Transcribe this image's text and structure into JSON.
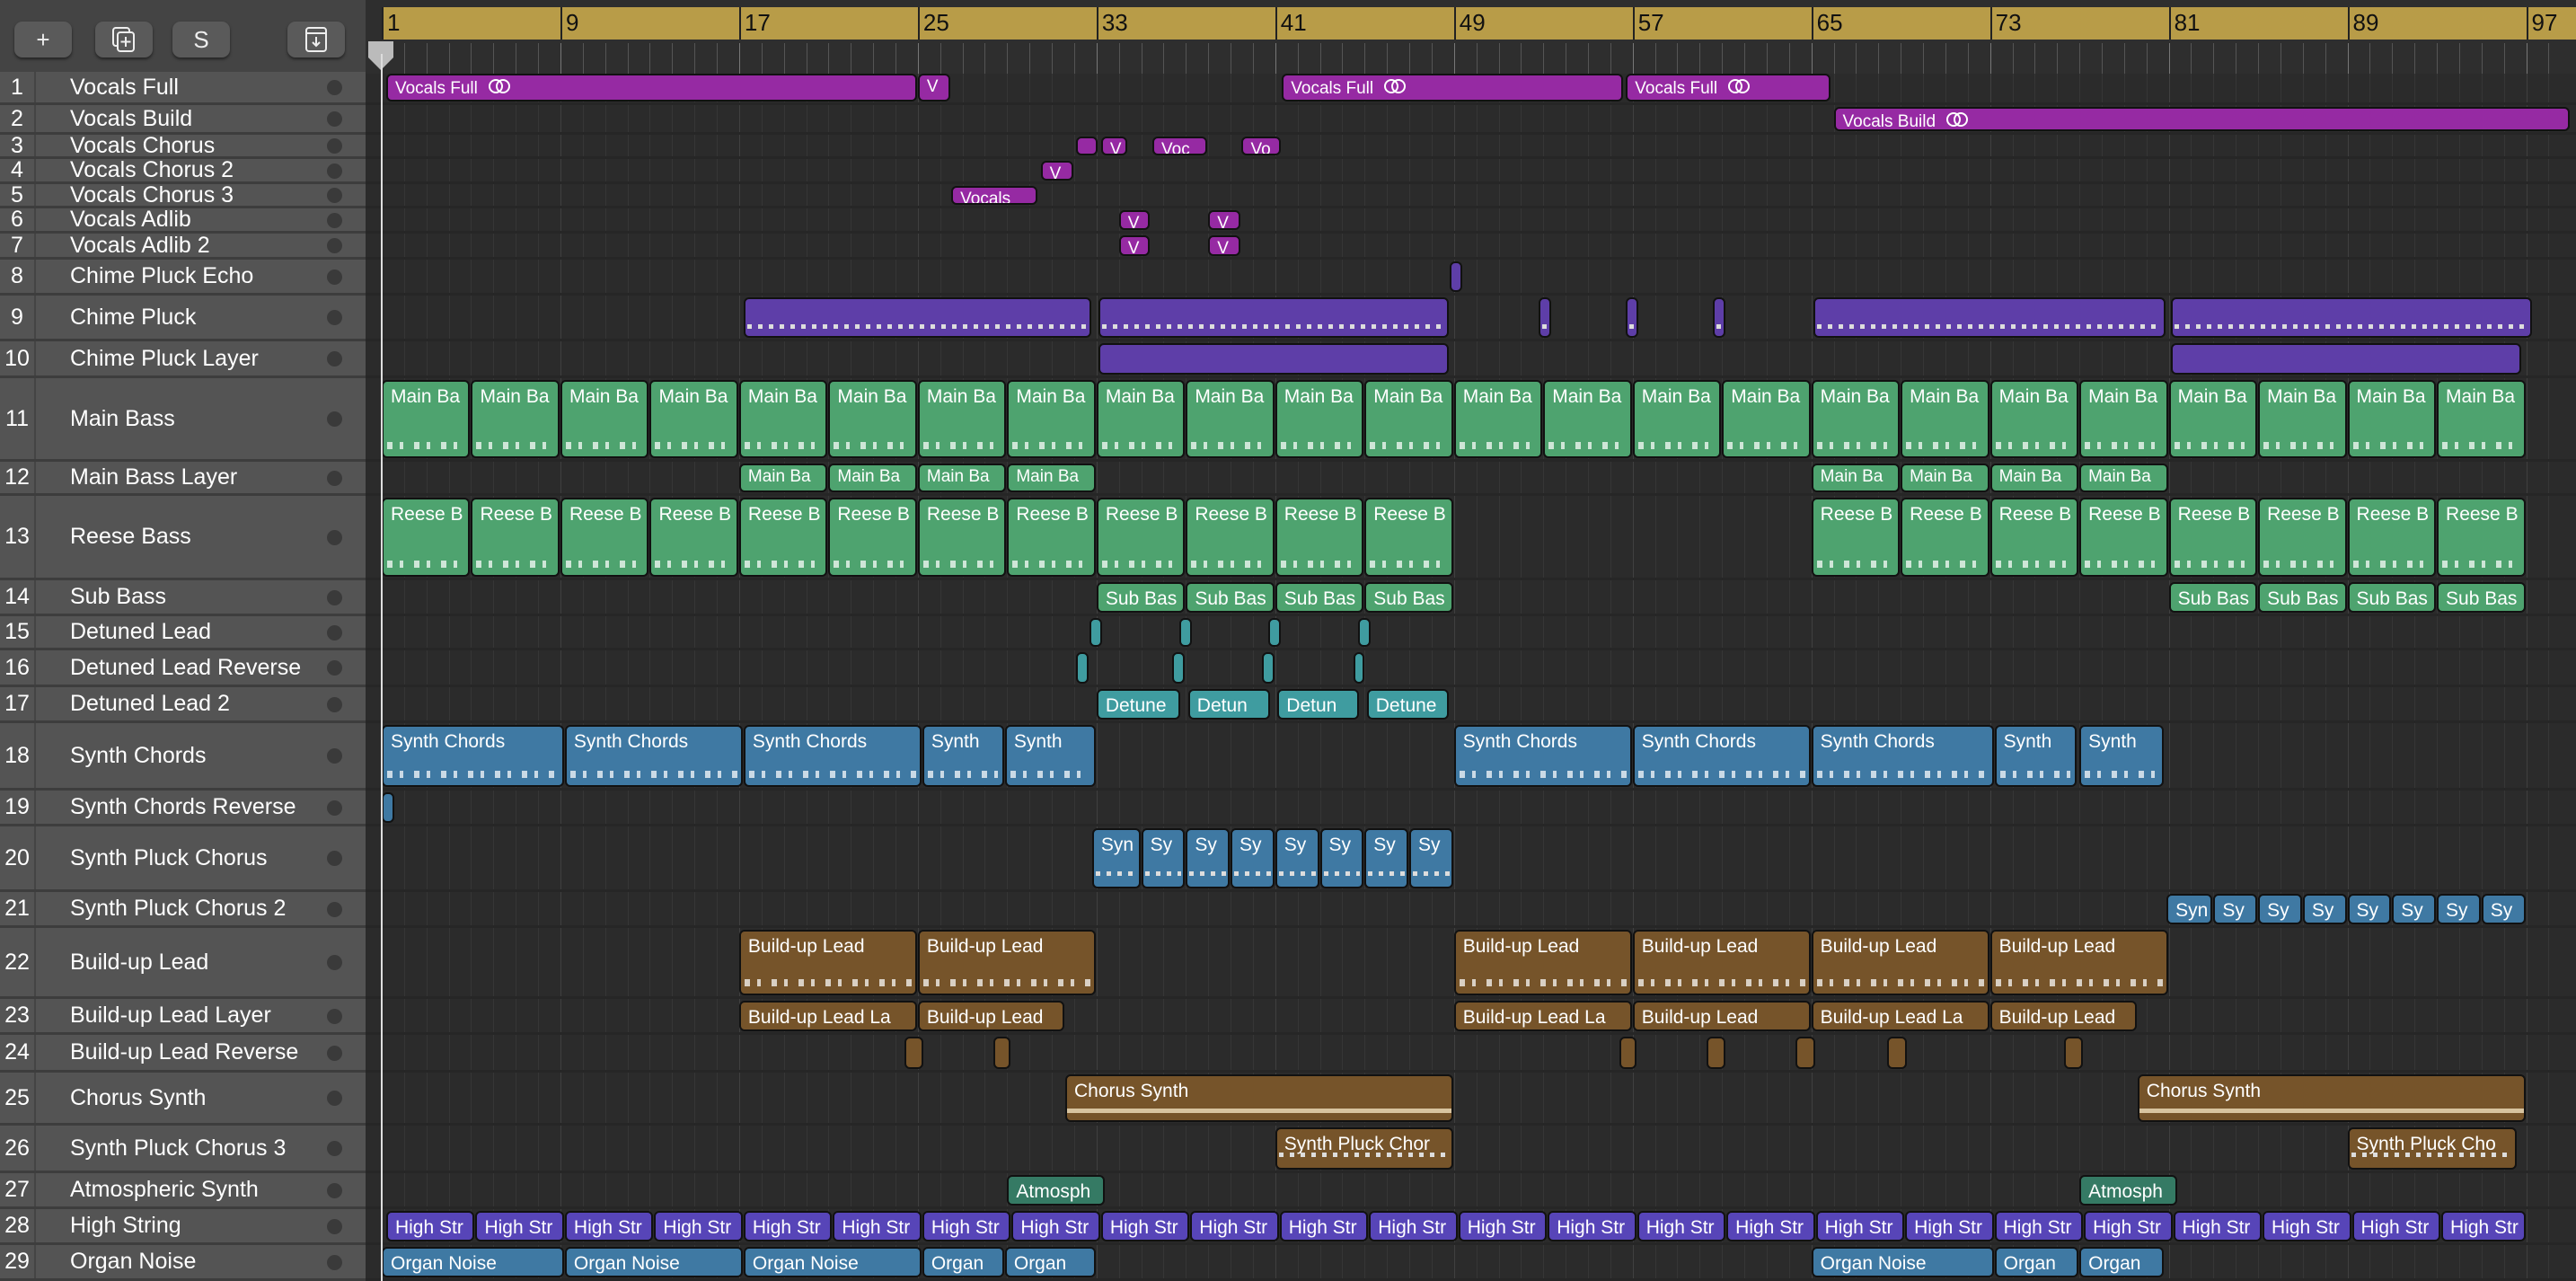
{
  "toolbar": {
    "add_label": "+",
    "duplicate_icon": "duplicate-track-icon",
    "solo_label": "S",
    "download_icon": "download-icon"
  },
  "ruler": {
    "bars": [
      "1",
      "9",
      "17",
      "25",
      "33",
      "41",
      "49",
      "57",
      "65",
      "73",
      "81",
      "89",
      "97"
    ]
  },
  "colors": {
    "vocals": "#962aa3",
    "chime": "#5e3ea8",
    "bass": "#4ea36f",
    "detuned": "#3f9ca0",
    "synth": "#3f79a3",
    "lead": "#76542a",
    "atmos": "#357a64",
    "string": "#5745b8",
    "header": "#545454",
    "ruler": "#b89c48"
  },
  "tracks": [
    {
      "num": "1",
      "name": "Vocals Full",
      "color": "vocals",
      "regions": [
        {
          "label": "Vocals Full",
          "start": 1.2,
          "end": 25,
          "loop": true
        },
        {
          "label": "V",
          "start": 25,
          "end": 26.5
        },
        {
          "label": "Vocals Full",
          "start": 41.3,
          "end": 56.6,
          "loop": true
        },
        {
          "label": "Vocals Full",
          "start": 56.7,
          "end": 65.9,
          "loop": true
        }
      ]
    },
    {
      "num": "2",
      "name": "Vocals Build",
      "color": "vocals",
      "regions": [
        {
          "label": "Vocals Build",
          "start": 66,
          "end": 99,
          "loop": true
        }
      ]
    },
    {
      "num": "3",
      "name": "Vocals Chorus",
      "color": "vocals",
      "regions": [
        {
          "label": "",
          "start": 32.1,
          "end": 33.1
        },
        {
          "label": "V",
          "start": 33.2,
          "end": 34.4
        },
        {
          "label": "Voc",
          "start": 35.5,
          "end": 38
        },
        {
          "label": "Vo",
          "start": 39.5,
          "end": 41.3
        }
      ]
    },
    {
      "num": "4",
      "name": "Vocals Chorus 2",
      "color": "vocals",
      "regions": [
        {
          "label": "V",
          "start": 30.5,
          "end": 32
        }
      ]
    },
    {
      "num": "5",
      "name": "Vocals Chorus 3",
      "color": "vocals",
      "regions": [
        {
          "label": "Vocals",
          "start": 26.5,
          "end": 30.4
        }
      ]
    },
    {
      "num": "6",
      "name": "Vocals Adlib",
      "color": "vocals",
      "regions": [
        {
          "label": "V",
          "start": 34,
          "end": 35.4
        },
        {
          "label": "V",
          "start": 38,
          "end": 39.5
        }
      ]
    },
    {
      "num": "7",
      "name": "Vocals Adlib 2",
      "color": "vocals",
      "regions": [
        {
          "label": "V",
          "start": 34,
          "end": 35.4
        },
        {
          "label": "V",
          "start": 38,
          "end": 39.5
        }
      ]
    },
    {
      "num": "8",
      "name": "Chime Pluck Echo",
      "color": "chime",
      "regions": [
        {
          "label": "",
          "start": 48.8,
          "end": 49.4
        }
      ]
    },
    {
      "num": "9",
      "name": "Chime Pluck",
      "color": "chime",
      "style": "sliced",
      "regions": [
        {
          "label": "",
          "start": 17.2,
          "end": 32.8
        },
        {
          "label": "",
          "start": 33.1,
          "end": 48.8
        },
        {
          "label": "",
          "start": 52.8,
          "end": 53.4
        },
        {
          "label": "",
          "start": 56.7,
          "end": 57.3
        },
        {
          "label": "",
          "start": 60.6,
          "end": 61.2
        },
        {
          "label": "",
          "start": 65.1,
          "end": 80.9
        },
        {
          "label": "",
          "start": 81.1,
          "end": 97.3
        }
      ]
    },
    {
      "num": "10",
      "name": "Chime Pluck Layer",
      "color": "chime",
      "style": "sliced",
      "regions": [
        {
          "label": "",
          "start": 33.1,
          "end": 48.8
        },
        {
          "label": "",
          "start": 81.1,
          "end": 96.8
        }
      ]
    },
    {
      "num": "11",
      "name": "Main Bass",
      "color": "bass",
      "style": "notes",
      "regions": [
        {
          "label": "Main Ba",
          "start": 1,
          "end": 97,
          "repeat": 4
        }
      ]
    },
    {
      "num": "12",
      "name": "Main Bass Layer",
      "color": "bass",
      "regions": [
        {
          "label": "Main Ba",
          "start": 17,
          "end": 33,
          "repeat": 4
        },
        {
          "label": "Main Ba",
          "start": 65,
          "end": 81,
          "repeat": 4
        }
      ]
    },
    {
      "num": "13",
      "name": "Reese Bass",
      "color": "bass",
      "style": "notes",
      "regions": [
        {
          "label": "Reese B",
          "start": 1,
          "end": 49,
          "repeat": 4
        },
        {
          "label": "Reese B",
          "start": 65,
          "end": 97,
          "repeat": 4
        }
      ]
    },
    {
      "num": "14",
      "name": "Sub Bass",
      "color": "bass",
      "regions": [
        {
          "label": "Sub Bas",
          "start": 33,
          "end": 49,
          "repeat": 4
        },
        {
          "label": "Sub Bas",
          "start": 81,
          "end": 97,
          "repeat": 4
        }
      ]
    },
    {
      "num": "15",
      "name": "Detuned Lead",
      "color": "detuned",
      "regions": [
        {
          "label": "",
          "start": 32.7,
          "end": 33.3
        },
        {
          "label": "",
          "start": 36.7,
          "end": 37.3
        },
        {
          "label": "",
          "start": 40.7,
          "end": 41.3
        },
        {
          "label": "",
          "start": 44.7,
          "end": 45.3
        }
      ]
    },
    {
      "num": "16",
      "name": "Detuned Lead Reverse",
      "color": "detuned",
      "regions": [
        {
          "label": "",
          "start": 32.1,
          "end": 32.7
        },
        {
          "label": "",
          "start": 36.4,
          "end": 37
        },
        {
          "label": "",
          "start": 40.4,
          "end": 41
        },
        {
          "label": "",
          "start": 44.5,
          "end": 45
        }
      ]
    },
    {
      "num": "17",
      "name": "Detuned Lead 2",
      "color": "detuned",
      "regions": [
        {
          "label": "Detune",
          "start": 33,
          "end": 36.8
        },
        {
          "label": "Detun",
          "start": 37.1,
          "end": 40.8
        },
        {
          "label": "Detun",
          "start": 41.1,
          "end": 44.8
        },
        {
          "label": "Detune",
          "start": 45.1,
          "end": 48.8
        }
      ]
    },
    {
      "num": "18",
      "name": "Synth Chords",
      "color": "synth",
      "style": "notes",
      "regions": [
        {
          "label": "Synth Chords",
          "start": 1,
          "end": 9.2
        },
        {
          "label": "Synth Chords",
          "start": 9.2,
          "end": 17.2
        },
        {
          "label": "Synth Chords",
          "start": 17.2,
          "end": 25.2
        },
        {
          "label": "Synth",
          "start": 25.2,
          "end": 28.9
        },
        {
          "label": "Synth",
          "start": 28.9,
          "end": 33
        },
        {
          "label": "Synth Chords",
          "start": 49,
          "end": 57
        },
        {
          "label": "Synth Chords",
          "start": 57,
          "end": 65
        },
        {
          "label": "Synth Chords",
          "start": 65,
          "end": 73.2
        },
        {
          "label": "Synth",
          "start": 73.2,
          "end": 76.9
        },
        {
          "label": "Synth",
          "start": 77,
          "end": 80.8
        }
      ]
    },
    {
      "num": "19",
      "name": "Synth Chords Reverse",
      "color": "synth",
      "regions": [
        {
          "label": "",
          "start": 1,
          "end": 1.6
        }
      ]
    },
    {
      "num": "20",
      "name": "Synth Pluck Chorus",
      "color": "synth",
      "style": "dots",
      "regions": [
        {
          "label": "Syn",
          "start": 32.8,
          "end": 35
        },
        {
          "label": "Sy",
          "start": 35,
          "end": 49,
          "repeat": 2
        }
      ]
    },
    {
      "num": "21",
      "name": "Synth Pluck Chorus 2",
      "color": "synth",
      "regions": [
        {
          "label": "Syn",
          "start": 80.9,
          "end": 83
        },
        {
          "label": "Sy",
          "start": 83,
          "end": 97,
          "repeat": 2
        }
      ]
    },
    {
      "num": "22",
      "name": "Build-up Lead",
      "color": "lead",
      "style": "notes",
      "regions": [
        {
          "label": "Build-up Lead",
          "start": 17,
          "end": 25
        },
        {
          "label": "Build-up Lead",
          "start": 25,
          "end": 33
        },
        {
          "label": "Build-up Lead",
          "start": 49,
          "end": 57
        },
        {
          "label": "Build-up Lead",
          "start": 57,
          "end": 65
        },
        {
          "label": "Build-up Lead",
          "start": 65,
          "end": 73
        },
        {
          "label": "Build-up Lead",
          "start": 73,
          "end": 81
        }
      ]
    },
    {
      "num": "23",
      "name": "Build-up Lead Layer",
      "color": "lead",
      "regions": [
        {
          "label": "Build-up Lead La",
          "start": 17,
          "end": 25
        },
        {
          "label": "Build-up Lead",
          "start": 25,
          "end": 31.6
        },
        {
          "label": "Build-up Lead La",
          "start": 49,
          "end": 57
        },
        {
          "label": "Build-up Lead",
          "start": 57,
          "end": 65
        },
        {
          "label": "Build-up Lead La",
          "start": 65,
          "end": 73
        },
        {
          "label": "Build-up Lead",
          "start": 73,
          "end": 79.6
        }
      ]
    },
    {
      "num": "24",
      "name": "Build-up Lead Reverse",
      "color": "lead",
      "regions": [
        {
          "label": "",
          "start": 24.4,
          "end": 25.3
        },
        {
          "label": "",
          "start": 28.4,
          "end": 29.2
        },
        {
          "label": "",
          "start": 56.4,
          "end": 57.2
        },
        {
          "label": "",
          "start": 60.3,
          "end": 61.2
        },
        {
          "label": "",
          "start": 64.3,
          "end": 65.2
        },
        {
          "label": "",
          "start": 68.4,
          "end": 69.3
        },
        {
          "label": "",
          "start": 76.3,
          "end": 77.2
        }
      ]
    },
    {
      "num": "25",
      "name": "Chorus Synth",
      "color": "lead",
      "style": "line",
      "regions": [
        {
          "label": "Chorus Synth",
          "start": 31.6,
          "end": 49
        },
        {
          "label": "Chorus Synth",
          "start": 79.6,
          "end": 97
        }
      ]
    },
    {
      "num": "26",
      "name": "Synth Pluck Chorus 3",
      "color": "lead",
      "style": "dots",
      "regions": [
        {
          "label": "Synth Pluck Chor",
          "start": 41,
          "end": 49
        },
        {
          "label": "Synth Pluck Cho",
          "start": 89,
          "end": 96.6
        }
      ]
    },
    {
      "num": "27",
      "name": "Atmospheric Synth",
      "color": "atmos",
      "regions": [
        {
          "label": "Atmosph",
          "start": 29,
          "end": 33.4
        },
        {
          "label": "Atmosph",
          "start": 77,
          "end": 81.4
        }
      ]
    },
    {
      "num": "28",
      "name": "High String",
      "color": "string",
      "regions": [
        {
          "label": "High Str",
          "start": 1.2,
          "end": 97,
          "repeat": 4
        }
      ]
    },
    {
      "num": "29",
      "name": "Organ Noise",
      "color": "synth",
      "regions": [
        {
          "label": "Organ Noise",
          "start": 1,
          "end": 9.2
        },
        {
          "label": "Organ Noise",
          "start": 9.2,
          "end": 17.2
        },
        {
          "label": "Organ Noise",
          "start": 17.2,
          "end": 25.2
        },
        {
          "label": "Organ",
          "start": 25.2,
          "end": 28.9
        },
        {
          "label": "Organ",
          "start": 28.9,
          "end": 33
        },
        {
          "label": "Organ Noise",
          "start": 65,
          "end": 73.2
        },
        {
          "label": "Organ",
          "start": 73.2,
          "end": 77
        },
        {
          "label": "Organ",
          "start": 77,
          "end": 80.8
        }
      ]
    }
  ]
}
